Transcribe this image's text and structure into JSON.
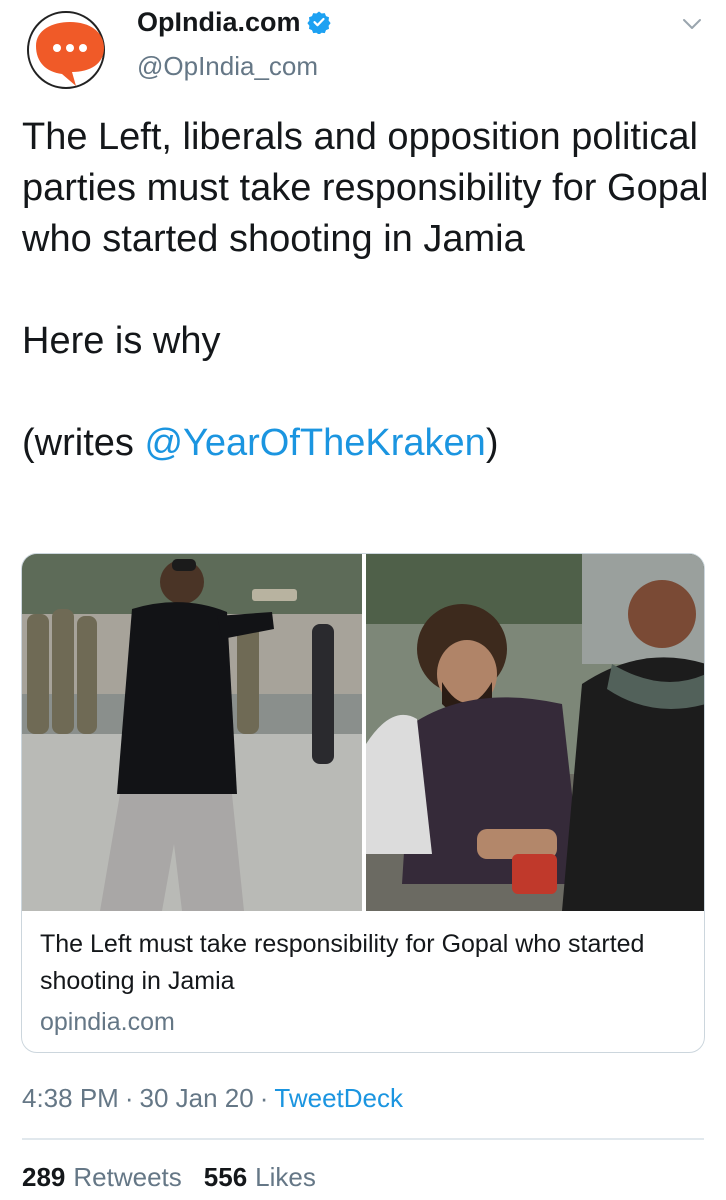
{
  "account": {
    "display_name": "OpIndia.com",
    "handle": "@OpIndia_com",
    "avatar_icon": "speech-bubble-icon",
    "verified_icon": "verified-badge-icon",
    "brand_color": "#f05a28"
  },
  "tweet": {
    "line1": "The Left, liberals and opposition political parties must take responsibility for Gopal who started shooting in Jamia",
    "line2": "Here is why",
    "line3_prefix": "(writes ",
    "line3_mention": "@YearOfTheKraken",
    "line3_suffix": ")"
  },
  "card": {
    "title": "The Left must take responsibility for Gopal who started shooting in Jamia",
    "domain": "opindia.com"
  },
  "meta": {
    "time": "4:38 PM",
    "date": "30 Jan 20",
    "separator": "·",
    "source": "TweetDeck"
  },
  "stats": {
    "retweets_count": "289",
    "retweets_label": "Retweets",
    "likes_count": "556",
    "likes_label": "Likes"
  },
  "colors": {
    "link": "#1b95e0",
    "secondary_text": "#657786",
    "border": "#ccd6dd"
  }
}
